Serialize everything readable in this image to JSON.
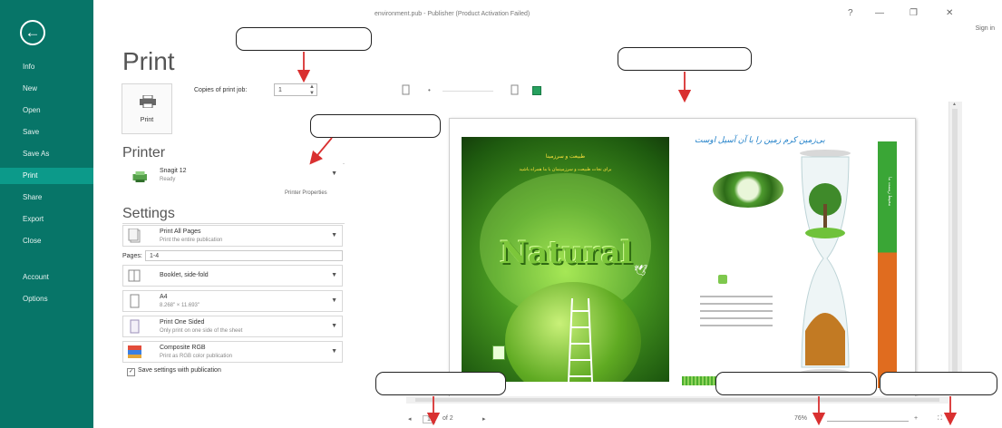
{
  "titlebar": {
    "title": "environment.pub - Publisher (Product Activation Failed)",
    "help": "?",
    "minimize": "—",
    "restore": "❐",
    "close": "✕",
    "sign_in": "Sign in"
  },
  "sidebar": {
    "back": "←",
    "items": [
      {
        "label": "Info"
      },
      {
        "label": "New"
      },
      {
        "label": "Open"
      },
      {
        "label": "Save"
      },
      {
        "label": "Save As"
      },
      {
        "label": "Print",
        "active": true
      },
      {
        "label": "Share"
      },
      {
        "label": "Export"
      },
      {
        "label": "Close"
      },
      {
        "label": "Account"
      },
      {
        "label": "Options"
      }
    ]
  },
  "print": {
    "heading": "Print",
    "button_label": "Print",
    "copies_label": "Copies of print job:",
    "copies_value": "1"
  },
  "printer": {
    "heading": "Printer",
    "name": "Snagit 12",
    "status": "Ready",
    "properties_link": "Printer Properties"
  },
  "settings": {
    "heading": "Settings",
    "pages_label": "Pages:",
    "pages_value": "1-4",
    "items": [
      {
        "title": "Print All Pages",
        "subtitle": "Print the entire publication"
      },
      {
        "title": "Booklet, side-fold",
        "subtitle": ""
      },
      {
        "title": "A4",
        "subtitle": "8.268\" × 11.693\""
      },
      {
        "title": "Print One Sided",
        "subtitle": "Only print on one side of the sheet"
      },
      {
        "title": "Composite RGB",
        "subtitle": "Print as RGB color publication"
      }
    ],
    "save_settings_label": "Save settings with publication"
  },
  "preview": {
    "cover_word": "Natural",
    "cover_header": "طبیعت و سرزمینا",
    "cover_sub": "برای نجات طبیعت و سرزمینمان با ما همراه باشید",
    "inside_banner": "بی‌زمین کرم زمین را با آن آسیل اوست",
    "strip_text": "محیط زیست ما"
  },
  "statusbar": {
    "page_prev": "◂",
    "page_num": "1",
    "page_of": "of 2",
    "page_next": "▸",
    "zoom": "76%",
    "zoom_minus": "−",
    "zoom_plus": "+",
    "fit": "⛶"
  },
  "colors": {
    "sidebar": "#077568",
    "sidebar_active": "#0c9a8a",
    "arrow": "#d93030"
  }
}
